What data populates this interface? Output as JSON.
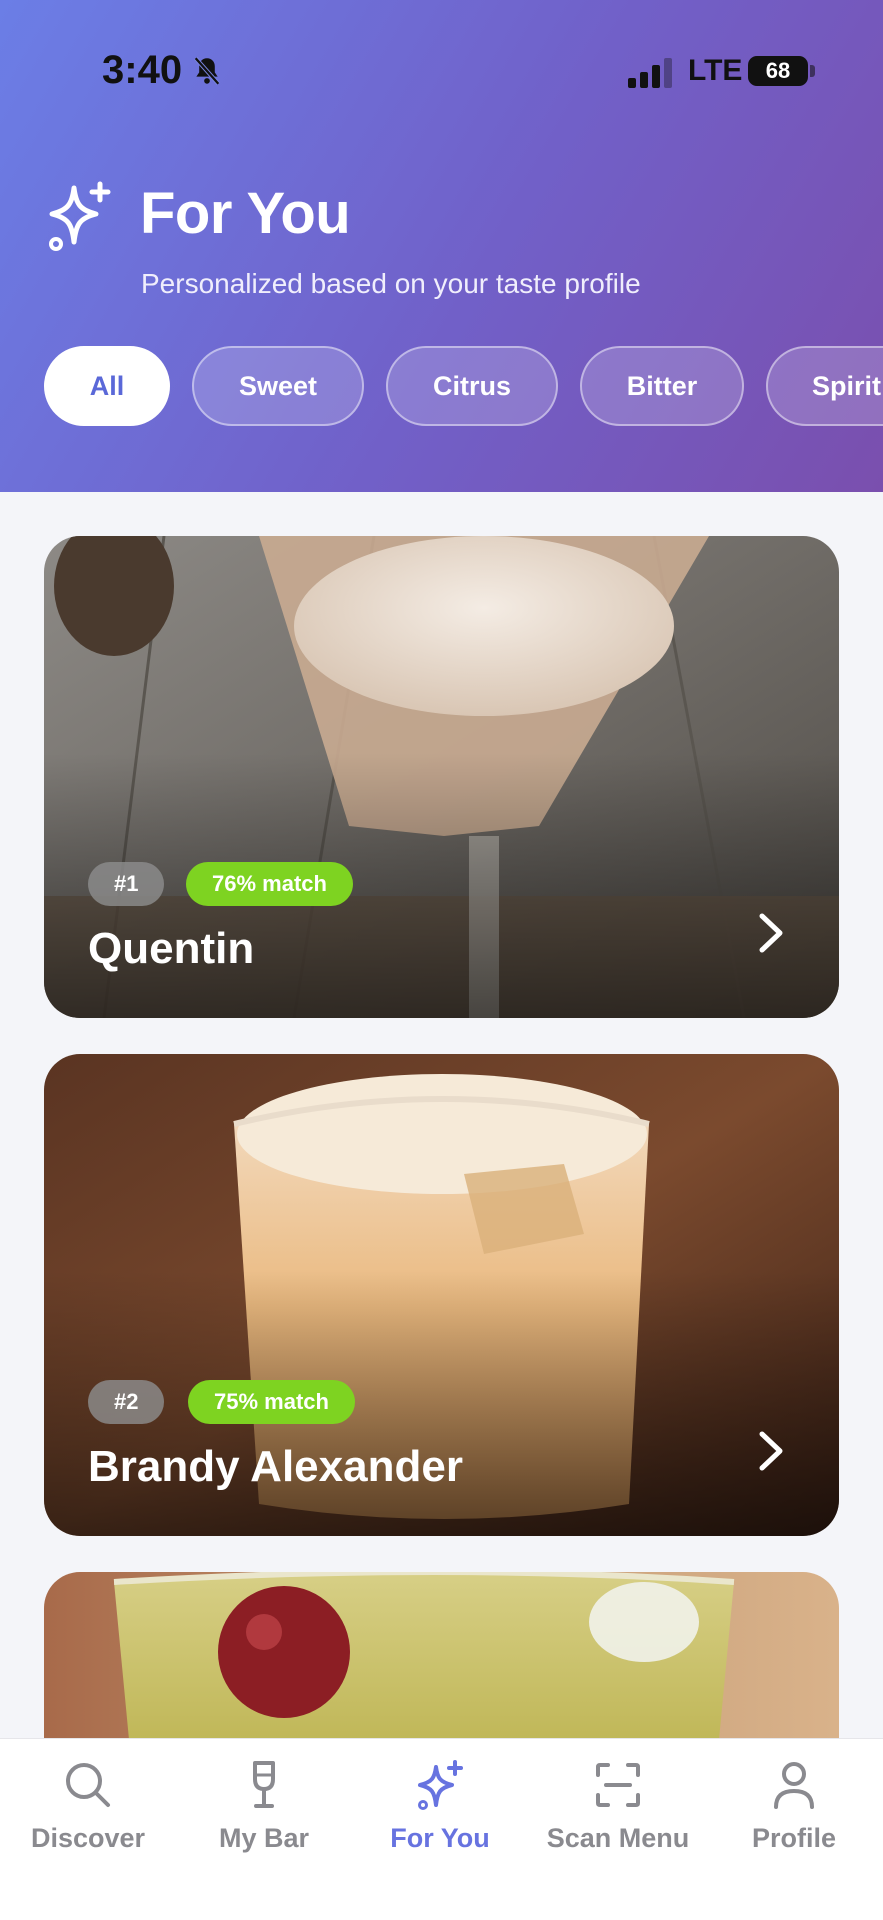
{
  "status_bar": {
    "time": "3:40",
    "network": "LTE",
    "battery": "68"
  },
  "header": {
    "title": "For You",
    "subtitle": "Personalized based on your taste profile",
    "icon": "sparkles-icon"
  },
  "filters": [
    {
      "label": "All",
      "active": true
    },
    {
      "label": "Sweet",
      "active": false
    },
    {
      "label": "Citrus",
      "active": false
    },
    {
      "label": "Bitter",
      "active": false
    },
    {
      "label": "Spirit",
      "active": false
    }
  ],
  "recommendations": [
    {
      "rank": "#1",
      "match": "76% match",
      "name": "Quentin"
    },
    {
      "rank": "#2",
      "match": "75% match",
      "name": "Brandy Alexander"
    }
  ],
  "tabs": [
    {
      "label": "Discover",
      "icon": "search-icon",
      "active": false
    },
    {
      "label": "My Bar",
      "icon": "wine-glass-icon",
      "active": false
    },
    {
      "label": "For You",
      "icon": "sparkles-icon",
      "active": true
    },
    {
      "label": "Scan Menu",
      "icon": "scan-icon",
      "active": false
    },
    {
      "label": "Profile",
      "icon": "person-icon",
      "active": false
    }
  ],
  "colors": {
    "accent": "#6773e0",
    "match_badge": "#7ed321",
    "gradient_start": "#6b7ee6",
    "gradient_end": "#7a4fae"
  }
}
